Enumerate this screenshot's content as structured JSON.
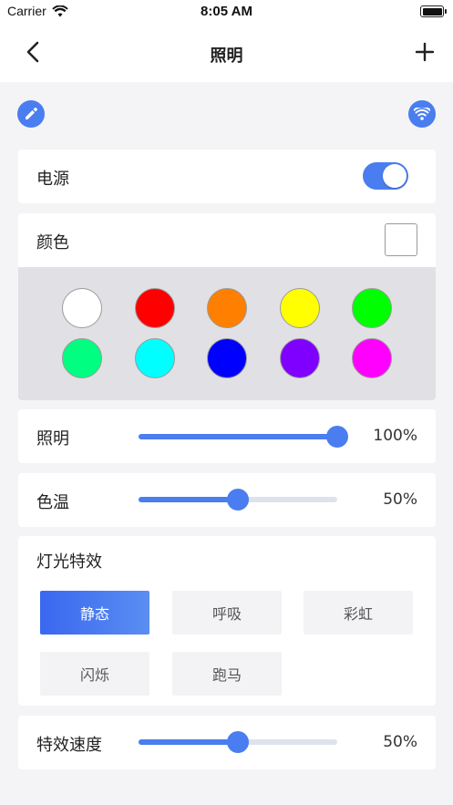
{
  "status_bar": {
    "carrier": "Carrier",
    "time": "8:05 AM"
  },
  "nav": {
    "title": "照明",
    "back_icon": "chevron-left-icon",
    "add_icon": "plus-icon"
  },
  "quick_actions": {
    "edit_icon": "pencil-icon",
    "wifi_icon": "wifi-icon"
  },
  "power": {
    "label": "电源",
    "on": true
  },
  "color": {
    "label": "颜色",
    "selected": "#ffffff",
    "swatches": [
      "#ffffff",
      "#ff0000",
      "#ff7f00",
      "#ffff00",
      "#00ff00",
      "#00ff80",
      "#00ffff",
      "#0000ff",
      "#8000ff",
      "#ff00ff"
    ]
  },
  "brightness": {
    "label": "照明",
    "value": "100%",
    "level": 1.0
  },
  "color_temp": {
    "label": "色温",
    "value": "50%",
    "level": 0.5
  },
  "effects": {
    "title": "灯光特效",
    "options": [
      "静态",
      "呼吸",
      "彩虹",
      "闪烁",
      "跑马"
    ],
    "selected_index": 0
  },
  "effect_speed": {
    "label": "特效速度",
    "value": "50%",
    "level": 0.5
  },
  "colors": {
    "accent": "#4a7df0",
    "background": "#f4f4f6",
    "palette_bg": "#e1e1e5"
  }
}
